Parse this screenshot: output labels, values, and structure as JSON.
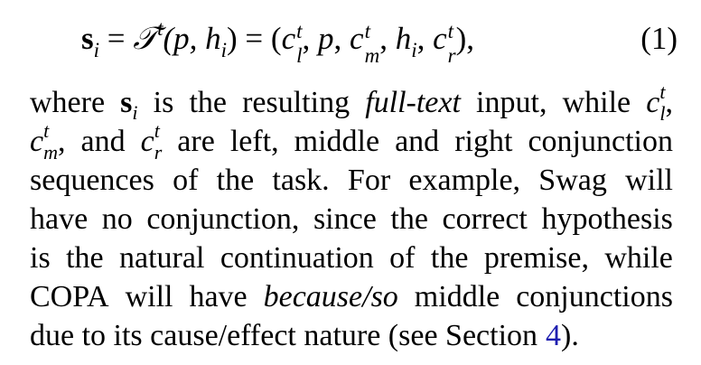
{
  "equation": {
    "lhs_symbol": "s",
    "lhs_sub": "i",
    "equals1": " = ",
    "op_symbol": "𝒯",
    "op_sup": "t",
    "op_args": "(p, h",
    "op_args_sub": "i",
    "op_args_close": ")",
    "equals2": " = ",
    "open": "(",
    "c": "c",
    "c_sup": "t",
    "c_l_sub": "l",
    "c_m_sub": "m",
    "c_r_sub": "r",
    "comma": ", ",
    "p": "p",
    "h": "h",
    "h_sub": "i",
    "close": "),",
    "number": "(1)"
  },
  "paragraph": {
    "line1": {
      "w1": "where",
      "s_sym": "s",
      "s_sub": "i",
      "w2": "is",
      "w3": "the",
      "w4": "resulting",
      "w5": "full-text",
      "w6": "input,",
      "w7": "while",
      "c_sym": "c",
      "c_sup": "t",
      "c_sub": "l",
      "trail": ","
    },
    "line2": {
      "c_m": "c",
      "c_m_sup": "t",
      "c_m_sub": "m",
      "c_m_trail": ",",
      "w1": "and",
      "c_r": "c",
      "c_r_sup": "t",
      "c_r_sub": "r",
      "words": [
        "are",
        "left,",
        "middle",
        "and",
        "right",
        "conjunction"
      ]
    },
    "line3": [
      "sequences",
      "of",
      "the",
      "task.",
      "For",
      "example,",
      "Swag",
      "will"
    ],
    "line4": [
      "have",
      "no",
      "conjunction,",
      "since",
      "the",
      "correct",
      "hypothesis"
    ],
    "line5": [
      "is",
      "the",
      "natural",
      "continuation",
      "of",
      "the",
      "premise,",
      "while"
    ],
    "line6": {
      "w1": "COPA",
      "w2": "will",
      "w3": "have",
      "w4": "because/so",
      "w5": "middle",
      "w6": "conjunctions"
    },
    "line7": {
      "text": "due to its cause/effect nature (see Section",
      "link": "4",
      "trail": ")."
    }
  }
}
